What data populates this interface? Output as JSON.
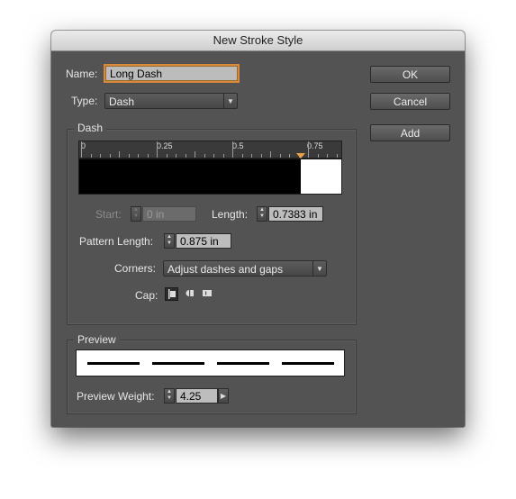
{
  "window": {
    "title": "New Stroke Style"
  },
  "name": {
    "label": "Name:",
    "value": "Long Dash"
  },
  "type": {
    "label": "Type:",
    "value": "Dash"
  },
  "buttons": {
    "ok": "OK",
    "cancel": "Cancel",
    "add": "Add"
  },
  "dash": {
    "group_title": "Dash",
    "ruler_labels": [
      "0",
      "0.25",
      "0.5",
      "0.75"
    ],
    "dash_length_fraction": 0.844,
    "start": {
      "label": "Start:",
      "value": "0 in"
    },
    "length": {
      "label": "Length:",
      "value": "0.7383 in"
    },
    "pattern_length": {
      "label": "Pattern Length:",
      "value": "0.875 in"
    },
    "corners": {
      "label": "Corners:",
      "value": "Adjust dashes and gaps"
    },
    "cap": {
      "label": "Cap:",
      "options": [
        "butt-cap-icon",
        "round-cap-icon",
        "projecting-cap-icon"
      ],
      "selected": "butt-cap-icon"
    }
  },
  "preview": {
    "group_title": "Preview",
    "weight_label": "Preview Weight:",
    "weight_value": "4.25"
  },
  "colors": {
    "dialog_bg": "#535353",
    "focus_ring": "#d8893a",
    "marker": "#e8a04a"
  }
}
